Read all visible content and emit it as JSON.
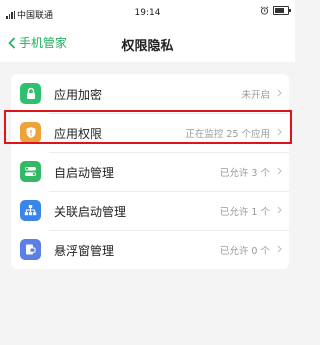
{
  "status_bar": {
    "carrier": "中国联通",
    "time": "19:14"
  },
  "nav": {
    "back_label": "手机管家",
    "title": "权限隐私"
  },
  "items": [
    {
      "label": "应用加密",
      "status": "未开启",
      "icon": "lock-icon",
      "color": "#2fbf71"
    },
    {
      "label": "应用权限",
      "status": "正在监控 25 个应用",
      "icon": "shield-icon",
      "color": "#f0a23a"
    },
    {
      "label": "自启动管理",
      "status": "已允许 3 个",
      "icon": "toggle-icon",
      "color": "#33b866"
    },
    {
      "label": "关联启动管理",
      "status": "已允许 1 个",
      "icon": "hierarchy-icon",
      "color": "#3a86e8"
    },
    {
      "label": "悬浮窗管理",
      "status": "已允许 0 个",
      "icon": "floating-window-icon",
      "color": "#5b7fe6"
    }
  ],
  "highlight_color": "#e0131b"
}
